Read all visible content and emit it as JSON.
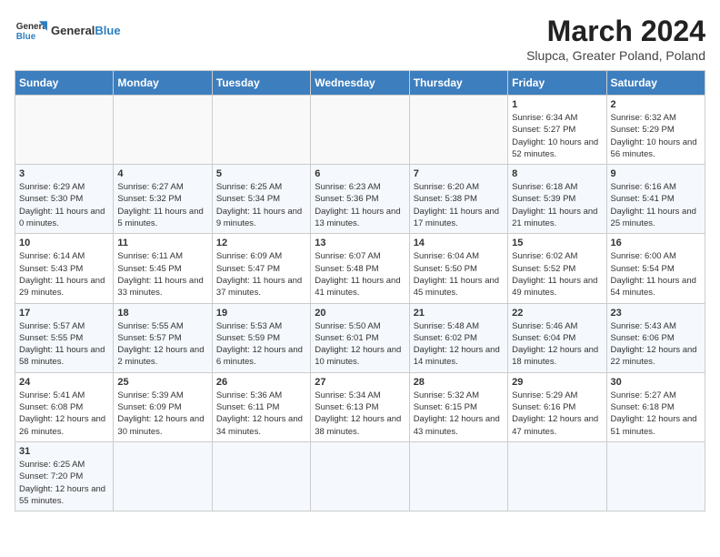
{
  "header": {
    "logo_general": "General",
    "logo_blue": "Blue",
    "month_year": "March 2024",
    "location": "Slupca, Greater Poland, Poland"
  },
  "weekdays": [
    "Sunday",
    "Monday",
    "Tuesday",
    "Wednesday",
    "Thursday",
    "Friday",
    "Saturday"
  ],
  "weeks": [
    [
      {
        "day": "",
        "info": ""
      },
      {
        "day": "",
        "info": ""
      },
      {
        "day": "",
        "info": ""
      },
      {
        "day": "",
        "info": ""
      },
      {
        "day": "",
        "info": ""
      },
      {
        "day": "1",
        "info": "Sunrise: 6:34 AM\nSunset: 5:27 PM\nDaylight: 10 hours and 52 minutes."
      },
      {
        "day": "2",
        "info": "Sunrise: 6:32 AM\nSunset: 5:29 PM\nDaylight: 10 hours and 56 minutes."
      }
    ],
    [
      {
        "day": "3",
        "info": "Sunrise: 6:29 AM\nSunset: 5:30 PM\nDaylight: 11 hours and 0 minutes."
      },
      {
        "day": "4",
        "info": "Sunrise: 6:27 AM\nSunset: 5:32 PM\nDaylight: 11 hours and 5 minutes."
      },
      {
        "day": "5",
        "info": "Sunrise: 6:25 AM\nSunset: 5:34 PM\nDaylight: 11 hours and 9 minutes."
      },
      {
        "day": "6",
        "info": "Sunrise: 6:23 AM\nSunset: 5:36 PM\nDaylight: 11 hours and 13 minutes."
      },
      {
        "day": "7",
        "info": "Sunrise: 6:20 AM\nSunset: 5:38 PM\nDaylight: 11 hours and 17 minutes."
      },
      {
        "day": "8",
        "info": "Sunrise: 6:18 AM\nSunset: 5:39 PM\nDaylight: 11 hours and 21 minutes."
      },
      {
        "day": "9",
        "info": "Sunrise: 6:16 AM\nSunset: 5:41 PM\nDaylight: 11 hours and 25 minutes."
      }
    ],
    [
      {
        "day": "10",
        "info": "Sunrise: 6:14 AM\nSunset: 5:43 PM\nDaylight: 11 hours and 29 minutes."
      },
      {
        "day": "11",
        "info": "Sunrise: 6:11 AM\nSunset: 5:45 PM\nDaylight: 11 hours and 33 minutes."
      },
      {
        "day": "12",
        "info": "Sunrise: 6:09 AM\nSunset: 5:47 PM\nDaylight: 11 hours and 37 minutes."
      },
      {
        "day": "13",
        "info": "Sunrise: 6:07 AM\nSunset: 5:48 PM\nDaylight: 11 hours and 41 minutes."
      },
      {
        "day": "14",
        "info": "Sunrise: 6:04 AM\nSunset: 5:50 PM\nDaylight: 11 hours and 45 minutes."
      },
      {
        "day": "15",
        "info": "Sunrise: 6:02 AM\nSunset: 5:52 PM\nDaylight: 11 hours and 49 minutes."
      },
      {
        "day": "16",
        "info": "Sunrise: 6:00 AM\nSunset: 5:54 PM\nDaylight: 11 hours and 54 minutes."
      }
    ],
    [
      {
        "day": "17",
        "info": "Sunrise: 5:57 AM\nSunset: 5:55 PM\nDaylight: 11 hours and 58 minutes."
      },
      {
        "day": "18",
        "info": "Sunrise: 5:55 AM\nSunset: 5:57 PM\nDaylight: 12 hours and 2 minutes."
      },
      {
        "day": "19",
        "info": "Sunrise: 5:53 AM\nSunset: 5:59 PM\nDaylight: 12 hours and 6 minutes."
      },
      {
        "day": "20",
        "info": "Sunrise: 5:50 AM\nSunset: 6:01 PM\nDaylight: 12 hours and 10 minutes."
      },
      {
        "day": "21",
        "info": "Sunrise: 5:48 AM\nSunset: 6:02 PM\nDaylight: 12 hours and 14 minutes."
      },
      {
        "day": "22",
        "info": "Sunrise: 5:46 AM\nSunset: 6:04 PM\nDaylight: 12 hours and 18 minutes."
      },
      {
        "day": "23",
        "info": "Sunrise: 5:43 AM\nSunset: 6:06 PM\nDaylight: 12 hours and 22 minutes."
      }
    ],
    [
      {
        "day": "24",
        "info": "Sunrise: 5:41 AM\nSunset: 6:08 PM\nDaylight: 12 hours and 26 minutes."
      },
      {
        "day": "25",
        "info": "Sunrise: 5:39 AM\nSunset: 6:09 PM\nDaylight: 12 hours and 30 minutes."
      },
      {
        "day": "26",
        "info": "Sunrise: 5:36 AM\nSunset: 6:11 PM\nDaylight: 12 hours and 34 minutes."
      },
      {
        "day": "27",
        "info": "Sunrise: 5:34 AM\nSunset: 6:13 PM\nDaylight: 12 hours and 38 minutes."
      },
      {
        "day": "28",
        "info": "Sunrise: 5:32 AM\nSunset: 6:15 PM\nDaylight: 12 hours and 43 minutes."
      },
      {
        "day": "29",
        "info": "Sunrise: 5:29 AM\nSunset: 6:16 PM\nDaylight: 12 hours and 47 minutes."
      },
      {
        "day": "30",
        "info": "Sunrise: 5:27 AM\nSunset: 6:18 PM\nDaylight: 12 hours and 51 minutes."
      }
    ],
    [
      {
        "day": "31",
        "info": "Sunrise: 6:25 AM\nSunset: 7:20 PM\nDaylight: 12 hours and 55 minutes."
      },
      {
        "day": "",
        "info": ""
      },
      {
        "day": "",
        "info": ""
      },
      {
        "day": "",
        "info": ""
      },
      {
        "day": "",
        "info": ""
      },
      {
        "day": "",
        "info": ""
      },
      {
        "day": "",
        "info": ""
      }
    ]
  ]
}
